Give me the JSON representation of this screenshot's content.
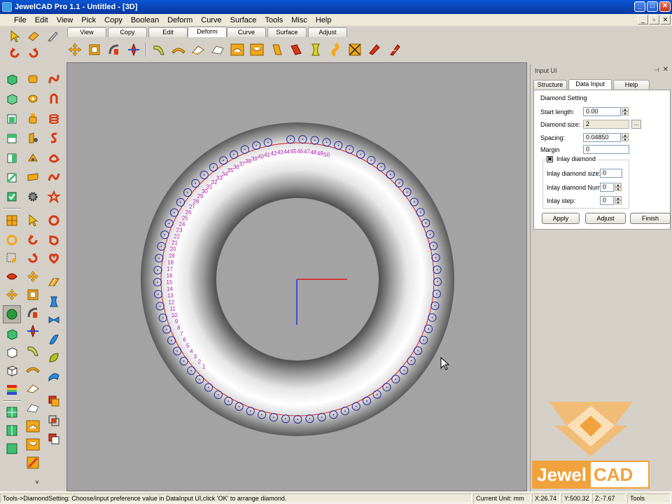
{
  "window": {
    "title": "JewelCAD Pro 1.1 - Untitled - [3D]"
  },
  "menu": [
    "File",
    "Edit",
    "View",
    "Pick",
    "Copy",
    "Boolean",
    "Deform",
    "Curve",
    "Surface",
    "Tools",
    "Misc",
    "Help"
  ],
  "ribbon_tabs": [
    "View",
    "Copy",
    "Edit",
    "Deform",
    "Curve",
    "Surface",
    "Adjust"
  ],
  "active_ribbon_tab": "Deform",
  "viewport": {
    "stone_labels": [
      "1",
      "2",
      "3",
      "4",
      "5",
      "6",
      "7",
      "8",
      "9",
      "10",
      "11",
      "12",
      "13",
      "14",
      "15",
      "16",
      "17",
      "18",
      "19",
      "20",
      "21",
      "22",
      "23",
      "24",
      "25",
      "26",
      "27",
      "28",
      "29",
      "30",
      "31",
      "32",
      "33",
      "34",
      "35",
      "36",
      "37",
      "38",
      "39",
      "40",
      "41",
      "42",
      "43",
      "44",
      "45",
      "46",
      "47",
      "48",
      "49",
      "50"
    ]
  },
  "input_ui": {
    "title": "Input UI",
    "tabs": [
      "Structure",
      "Data Input",
      "Help"
    ],
    "active_tab": "Data Input",
    "group_title": "Diamond Setting",
    "start_length_label": "Start length:",
    "start_length_value": "0.00",
    "diamond_size_label": "Diamond size:",
    "diamond_size_value": "2",
    "spacing_label": "Spacing:",
    "spacing_value": "0.04850",
    "margin_label": "Margin",
    "margin_value": "0",
    "inlay_checkbox_label": "Inlay diamond",
    "inlay_checked": "✖",
    "inlay_size_label": "Inlay diamond size:",
    "inlay_size_value": "0",
    "inlay_num_label": "Inlay diamond Num:",
    "inlay_num_value": "0",
    "inlay_step_label": "Inlay step:",
    "inlay_step_value": "0",
    "apply_label": "Apply",
    "adjust_label": "Adjust",
    "finish_label": "Finish"
  },
  "logo": {
    "left": "Jewel",
    "right": "CAD"
  },
  "status": {
    "message": "Tools->DiamondSetting: Choose/input preference value in DataInput UI,click 'OK' to arrange diamond.",
    "unit": "Current Unit:  mm",
    "x": "X:26.74",
    "y": "Y:500.32",
    "z": "Z:-7.67",
    "tools": "Tools"
  },
  "colors": {
    "title_blue": "#0842b0",
    "stone_outline": "#2a2aa8",
    "label_magenta": "#b021b0",
    "curve_red": "#e01818",
    "logo_orange": "#f1a23c"
  }
}
